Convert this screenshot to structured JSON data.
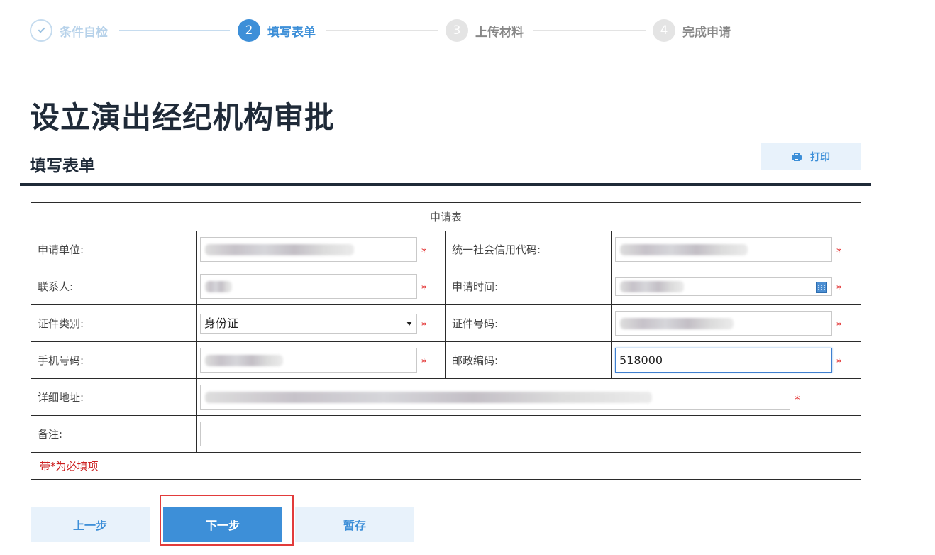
{
  "stepper": {
    "steps": [
      {
        "number": "✓",
        "label": "条件自检",
        "state": "done"
      },
      {
        "number": "2",
        "label": "填写表单",
        "state": "active"
      },
      {
        "number": "3",
        "label": "上传材料",
        "state": "todo"
      },
      {
        "number": "4",
        "label": "完成申请",
        "state": "todo"
      }
    ]
  },
  "page": {
    "title": "设立演出经纪机构审批",
    "section_title": "填写表单",
    "print_label": "打印"
  },
  "form": {
    "table_title": "申请表",
    "required_mark": "*",
    "fields": {
      "applicant_unit": {
        "label": "申请单位:",
        "value": ""
      },
      "credit_code": {
        "label": "统一社会信用代码:",
        "value": ""
      },
      "contact": {
        "label": "联系人:",
        "value": ""
      },
      "apply_time": {
        "label": "申请时间:",
        "value": ""
      },
      "id_type": {
        "label": "证件类别:",
        "value": "身份证"
      },
      "id_number": {
        "label": "证件号码:",
        "value": ""
      },
      "mobile": {
        "label": "手机号码:",
        "value": ""
      },
      "postcode": {
        "label": "邮政编码:",
        "value": "518000"
      },
      "address": {
        "label": "详细地址:",
        "value": ""
      },
      "remark": {
        "label": "备注:",
        "value": ""
      }
    },
    "note": "带*为必填项"
  },
  "buttons": {
    "prev": "上一步",
    "next": "下一步",
    "save": "暂存"
  },
  "colors": {
    "accent": "#3d8fd8",
    "accent_light": "#e8f2fb",
    "title_dark": "#1f2a38",
    "required_red": "#e02020",
    "highlight_red": "#e23b3b"
  }
}
